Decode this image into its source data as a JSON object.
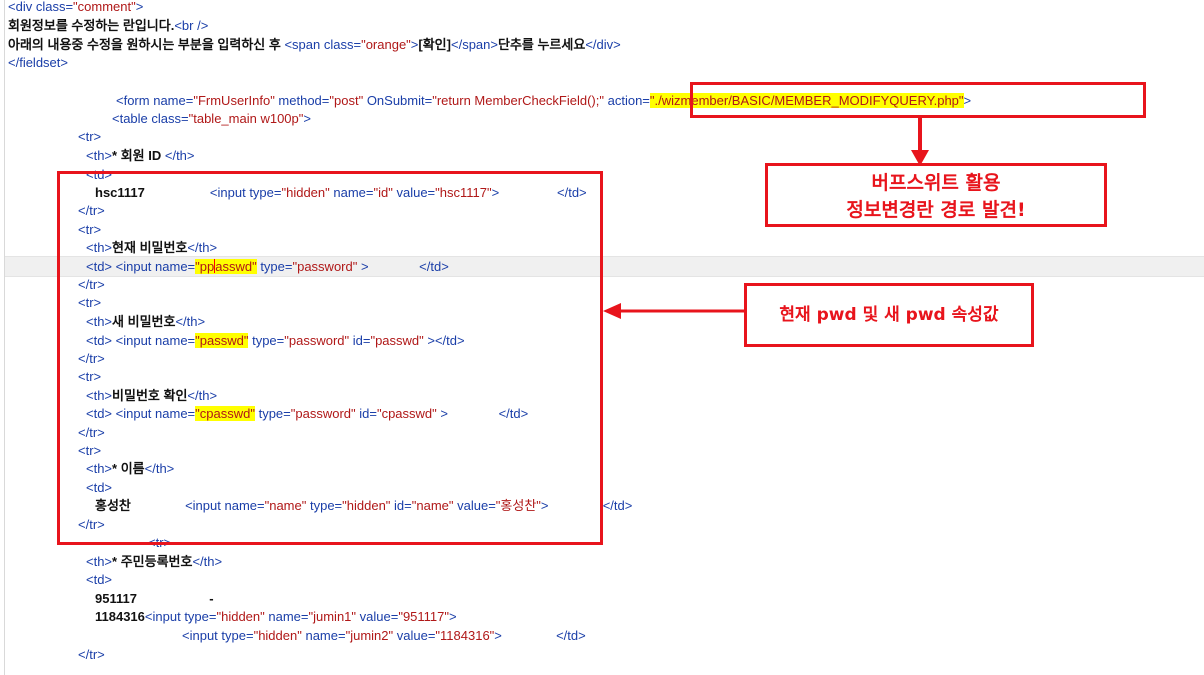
{
  "code_lines": [
    {
      "html": "<span class=\"t\">&lt;div </span><span class=\"a\">class=</span><span class=\"v\">\"comment\"</span><span class=\"t\">&gt;</span>"
    },
    {
      "html": "<span class=\"k\">회원정보를 수정하는 란입니다.</span><span class=\"t\">&lt;br /&gt;</span>"
    },
    {
      "html": "<span class=\"k\">아래의 내용중 수정을 원하시는 부분을 입력하신 후 </span><span class=\"t\">&lt;span </span><span class=\"a\">class=</span><span class=\"v\">\"orange\"</span><span class=\"t\">&gt;</span><span class=\"k\">[확인]</span><span class=\"t\">&lt;/span&gt;</span><span class=\"k\">단추를 누르세요</span><span class=\"t\">&lt;/div&gt;</span>"
    },
    {
      "html": "<span class=\"t\">&lt;/fieldset&gt;</span>"
    },
    {
      "html": "<span class=\"t\">&lt;form </span><span class=\"a\">name=</span><span class=\"v\">\"FrmUserInfo\"</span><span class=\"a\"> method=</span><span class=\"v\">\"post\"</span><span class=\"a\"> OnSubmit=</span><span class=\"v\">\"return MemberCheckField();\"</span><span class=\"a\"> action=</span><span class=\"v hl\">\"./wizmember/BASIC/MEMBER_MODIFYQUERY.php\"</span><span class=\"t\">&gt;</span>"
    },
    {
      "html": "<span class=\"t\">&lt;table </span><span class=\"a\">class=</span><span class=\"v\">\"table_main w100p\"</span><span class=\"t\">&gt;</span>"
    },
    {
      "html": "<span class=\"t\">&lt;tr&gt;</span>"
    },
    {
      "html": "<span class=\"t\">&lt;th&gt;</span><span class=\"k\">* 회원 ID </span><span class=\"t\">&lt;/th&gt;</span>"
    },
    {
      "html": "<span class=\"t\">&lt;td&gt;</span>"
    },
    {
      "html": "<span class=\"k\">hsc1117</span>                  <span class=\"t\">&lt;input </span><span class=\"a\">type=</span><span class=\"v\">\"hidden\"</span><span class=\"a\"> name=</span><span class=\"v\">\"id\"</span><span class=\"a\"> value=</span><span class=\"v\">\"hsc1117\"</span><span class=\"t\">&gt;</span>                <span class=\"t\">&lt;/td&gt;</span>"
    },
    {
      "html": "<span class=\"t\">&lt;/tr&gt;</span>"
    },
    {
      "html": "<span class=\"t\">&lt;tr&gt;</span>"
    },
    {
      "html": "<span class=\"t\">&lt;th&gt;</span><span class=\"k\">현재 비밀번호</span><span class=\"t\">&lt;/th&gt;</span>"
    },
    {
      "html": "<span class=\"t\">&lt;td&gt; &lt;input </span><span class=\"a\">name=</span><span class=\"v hl\">\"pp<span class=\"caret\"></span>asswd\"</span><span class=\"a\"> type=</span><span class=\"v\">\"password\"</span><span class=\"t\"> &gt;</span>              <span class=\"t\">&lt;/td&gt;</span>"
    },
    {
      "html": "<span class=\"t\">&lt;/tr&gt;</span>"
    },
    {
      "html": "<span class=\"t\">&lt;tr&gt;</span>"
    },
    {
      "html": "<span class=\"t\">&lt;th&gt;</span><span class=\"k\">새 비밀번호</span><span class=\"t\">&lt;/th&gt;</span>"
    },
    {
      "html": "<span class=\"t\">&lt;td&gt; &lt;input </span><span class=\"a\">name=</span><span class=\"v hl\">\"passwd\"</span><span class=\"a\"> type=</span><span class=\"v\">\"password\"</span><span class=\"a\"> id=</span><span class=\"v\">\"passwd\"</span><span class=\"t\"> &gt;&lt;/td&gt;</span>"
    },
    {
      "html": "<span class=\"t\">&lt;/tr&gt;</span>"
    },
    {
      "html": "<span class=\"t\">&lt;tr&gt;</span>"
    },
    {
      "html": "<span class=\"t\">&lt;th&gt;</span><span class=\"k\">비밀번호 확인</span><span class=\"t\">&lt;/th&gt;</span>"
    },
    {
      "html": "<span class=\"t\">&lt;td&gt; &lt;input </span><span class=\"a\">name=</span><span class=\"v hl\">\"cpasswd\"</span><span class=\"a\"> type=</span><span class=\"v\">\"password\"</span><span class=\"a\"> id=</span><span class=\"v\">\"cpasswd\"</span><span class=\"t\"> &gt;</span>              <span class=\"t\">&lt;/td&gt;</span>"
    },
    {
      "html": "<span class=\"t\">&lt;/tr&gt;</span>"
    },
    {
      "html": "<span class=\"t\">&lt;tr&gt;</span>"
    },
    {
      "html": "<span class=\"t\">&lt;th&gt;</span><span class=\"k\">* 이름</span><span class=\"t\">&lt;/th&gt;</span>"
    },
    {
      "html": "<span class=\"t\">&lt;td&gt;</span>"
    },
    {
      "html": "<span class=\"k\">홍성찬</span>               <span class=\"t\">&lt;input </span><span class=\"a\">name=</span><span class=\"v\">\"name\"</span><span class=\"a\"> type=</span><span class=\"v\">\"hidden\"</span><span class=\"a\"> id=</span><span class=\"v\">\"name\"</span><span class=\"a\"> value=</span><span class=\"v\">\"홍성찬\"</span><span class=\"t\">&gt;</span>               <span class=\"t\">&lt;/td&gt;</span>"
    },
    {
      "html": "<span class=\"t\">&lt;/tr&gt;</span>"
    },
    {
      "html": "<span class=\"t\">&lt;tr&gt;</span>"
    },
    {
      "html": "<span class=\"t\">&lt;th&gt;</span><span class=\"k\">* 주민등록번호</span><span class=\"t\">&lt;/th&gt;</span>"
    },
    {
      "html": "<span class=\"t\">&lt;td&gt;</span>"
    },
    {
      "html": "<span class=\"k\">951117</span>                    <span class=\"k\">-</span>"
    },
    {
      "html": "<span class=\"k\">1184316</span><span class=\"t\">&lt;input </span><span class=\"a\">type=</span><span class=\"v\">\"hidden\"</span><span class=\"a\"> name=</span><span class=\"v\">\"jumin1\"</span><span class=\"a\"> value=</span><span class=\"v\">\"951117\"</span><span class=\"t\">&gt;</span>"
    },
    {
      "html": "<span class=\"t\">&lt;input </span><span class=\"a\">type=</span><span class=\"v\">\"hidden\"</span><span class=\"a\"> name=</span><span class=\"v\">\"jumin2\"</span><span class=\"a\"> value=</span><span class=\"v\">\"1184316\"</span><span class=\"t\">&gt;</span>               <span class=\"t\">&lt;/td&gt;</span>"
    },
    {
      "html": "<span class=\"t\">&lt;/tr&gt;</span>"
    }
  ],
  "annotations": {
    "callout_top_line1": "버프스위트 활용",
    "callout_top_line2": "정보변경란 경로 발견!",
    "callout_right": "현재 pwd 및 새 pwd 속성값"
  },
  "colors": {
    "annotation_red": "#e8141c",
    "highlight_yellow": "#ffff00",
    "tag_blue": "#1a3ea8",
    "value_red": "#b01818"
  }
}
